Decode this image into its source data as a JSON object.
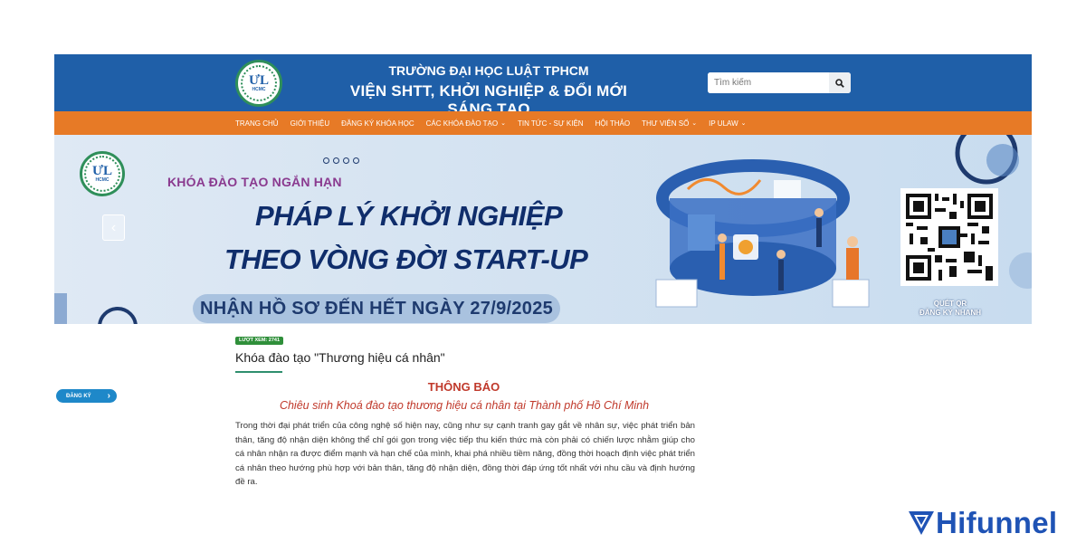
{
  "header": {
    "logo_text": "ƯL",
    "logo_sub": "HCMC",
    "title_line1": "TRƯỜNG ĐẠI HỌC LUẬT TPHCM",
    "title_line2": "VIỆN SHTT, KHỞI NGHIỆP & ĐỔI MỚI SÁNG TẠO",
    "search_placeholder": "Tìm kiếm",
    "search_icon": "search-icon"
  },
  "nav": {
    "items": [
      {
        "label": "TRANG CHỦ"
      },
      {
        "label": "GIỚI THIỆU"
      },
      {
        "label": "ĐĂNG KÝ KHÓA HỌC"
      },
      {
        "label": "CÁC KHÓA ĐÀO TẠO",
        "dropdown": true
      },
      {
        "label": "TIN TỨC - SỰ KIỆN"
      },
      {
        "label": "HỘI THẢO"
      },
      {
        "label": "THƯ VIỆN SỐ",
        "dropdown": true
      },
      {
        "label": "IP ULAW",
        "dropdown": true
      }
    ],
    "caret": "⌄"
  },
  "banner": {
    "kicker": "KHÓA ĐÀO TẠO NGẮN HẠN",
    "line1": "PHÁP LÝ KHỞI NGHIỆP",
    "line2": "THEO VÒNG ĐỜI START-UP",
    "deadline": "NHẬN HỒ SƠ ĐẾN HẾT NGÀY 27/9/2025",
    "qr_caption_1": "QUÉT QR",
    "qr_caption_2": "ĐĂNG KÝ NHANH",
    "prev_arrow": "‹"
  },
  "post": {
    "views": "LƯỢT XEM: 2741",
    "title": "Khóa đào tạo \"Thương hiệu cá nhân\"",
    "notice": "THÔNG BÁO",
    "notice_sub": "Chiêu sinh Khoá đào tạo thương hiệu cá nhân tại Thành phố Hồ Chí Minh",
    "body": "Trong thời đại phát triển của công nghệ số hiện nay, cũng như sự cạnh tranh gay gắt về nhân sự, việc phát triển bản thân, tăng độ nhận diện không thể chỉ gói gọn trong việc tiếp thu kiến thức mà còn phải có chiến lược nhằm giúp cho cá nhân nhận ra được điểm mạnh và hạn chế của mình, khai phá nhiều tiềm năng, đồng thời hoạch định việc phát triển cá nhân theo hướng phù hợp với bản thân, tăng độ nhận diện, đồng thời đáp ứng tốt nhất với nhu cầu và định hướng đề ra."
  },
  "sidebar": {
    "register_label": "ĐĂNG KÝ",
    "register_arrow": "›"
  },
  "watermark": {
    "text": "Hifunnel"
  },
  "colors": {
    "header_blue": "#1f5fa8",
    "nav_orange": "#e77a26",
    "notice_red": "#c0392b",
    "accent_green": "#2f8f3a"
  }
}
